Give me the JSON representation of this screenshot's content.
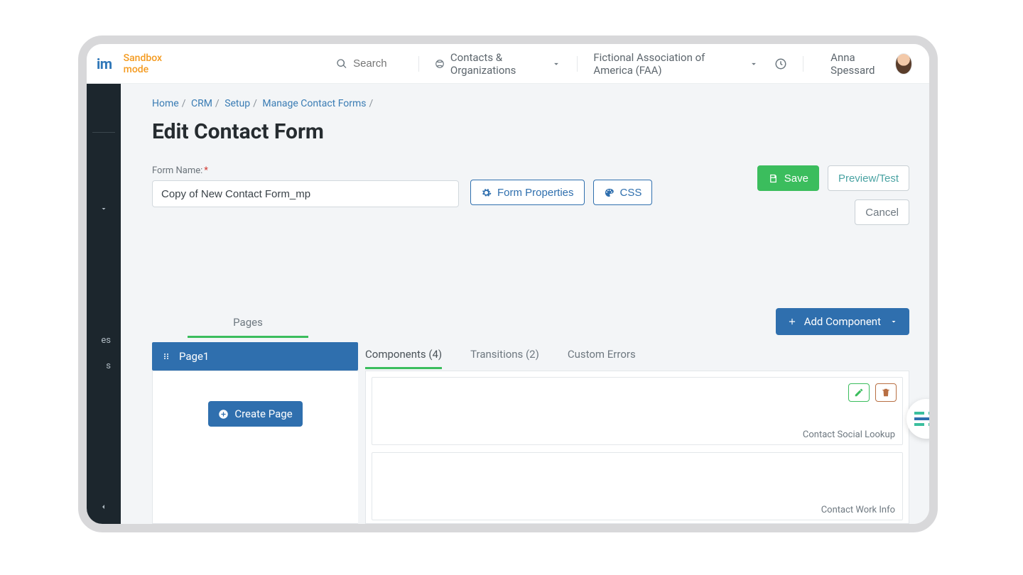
{
  "topbar": {
    "logo_fragment": "im",
    "sandbox_label": "Sandbox mode",
    "search_placeholder": "Search",
    "nav_contacts": "Contacts & Organizations",
    "org_name": "Fictional Association of America (FAA)",
    "user_name": "Anna Spessard"
  },
  "breadcrumb": {
    "home": "Home",
    "crm": "CRM",
    "setup": "Setup",
    "manage": "Manage Contact Forms"
  },
  "page": {
    "title": "Edit Contact Form",
    "form_name_label": "Form Name:",
    "form_name_value": "Copy of New Contact Form_mp",
    "btn_form_properties": "Form Properties",
    "btn_css": "CSS",
    "btn_save": "Save",
    "btn_preview": "Preview/Test",
    "btn_cancel": "Cancel"
  },
  "editor": {
    "pages_tab": "Pages",
    "page_item": "Page1",
    "create_page": "Create Page",
    "add_component": "Add Component",
    "sub_tabs": {
      "components": "Components (4)",
      "transitions": "Transitions (2)",
      "custom_errors": "Custom Errors"
    },
    "components": [
      {
        "label": "Contact Social Lookup"
      },
      {
        "label": "Contact Work Info"
      }
    ]
  }
}
